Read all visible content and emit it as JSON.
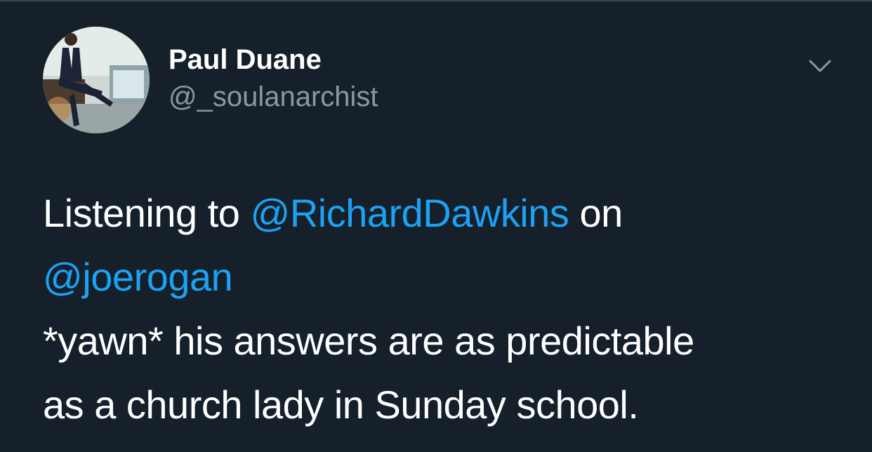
{
  "tweet": {
    "author": {
      "display_name": "Paul Duane",
      "handle": "@_soulanarchist"
    },
    "menu_icon": "chevron-down-icon",
    "body": {
      "line1_prefix": "Listening to ",
      "mention1": "@RichardDawkins",
      "line1_suffix": " on",
      "mention2": "@joerogan",
      "line3": "*yawn* his answers are as predictable",
      "line4": "as a church lady in Sunday school."
    }
  },
  "colors": {
    "background": "#15202b",
    "text": "#ffffff",
    "secondary_text": "#8899a6",
    "mention": "#1da1f2"
  }
}
